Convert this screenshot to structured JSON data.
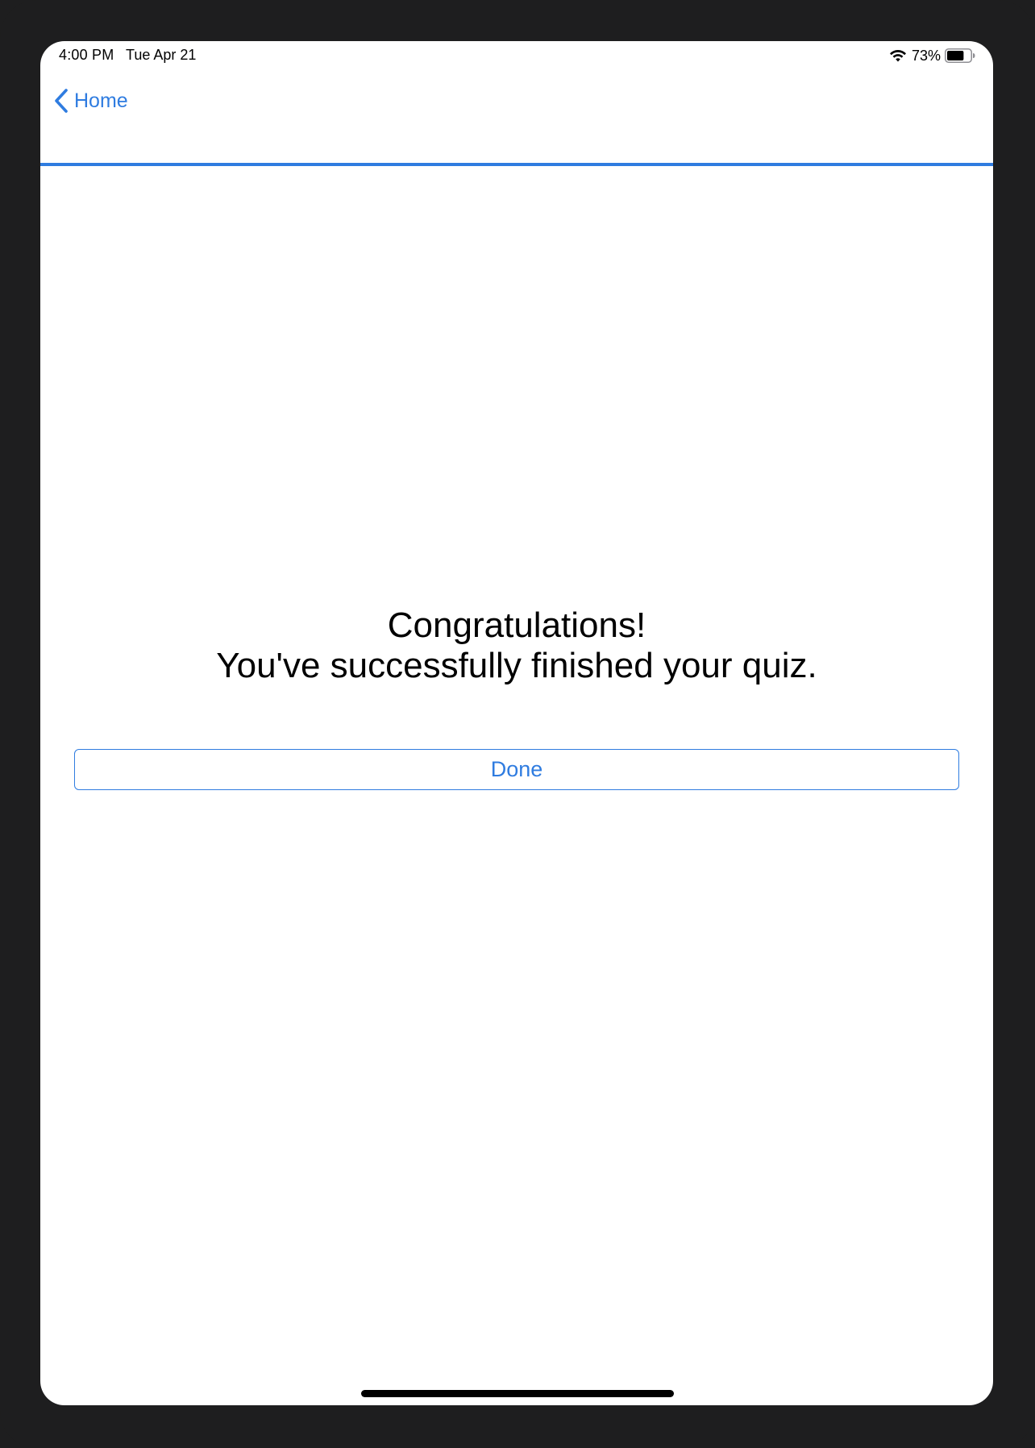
{
  "status_bar": {
    "time": "4:00 PM",
    "date": "Tue Apr 21",
    "battery_percent": "73%",
    "battery_level": 0.73,
    "wifi_icon": "wifi-icon",
    "battery_icon": "battery-icon"
  },
  "nav": {
    "back_label": "Home",
    "back_icon": "chevron-left-icon",
    "accent_color": "#2f7ce0"
  },
  "main": {
    "message_line1": "Congratulations!",
    "message_line2": "You've successfully finished your quiz.",
    "done_label": "Done"
  }
}
